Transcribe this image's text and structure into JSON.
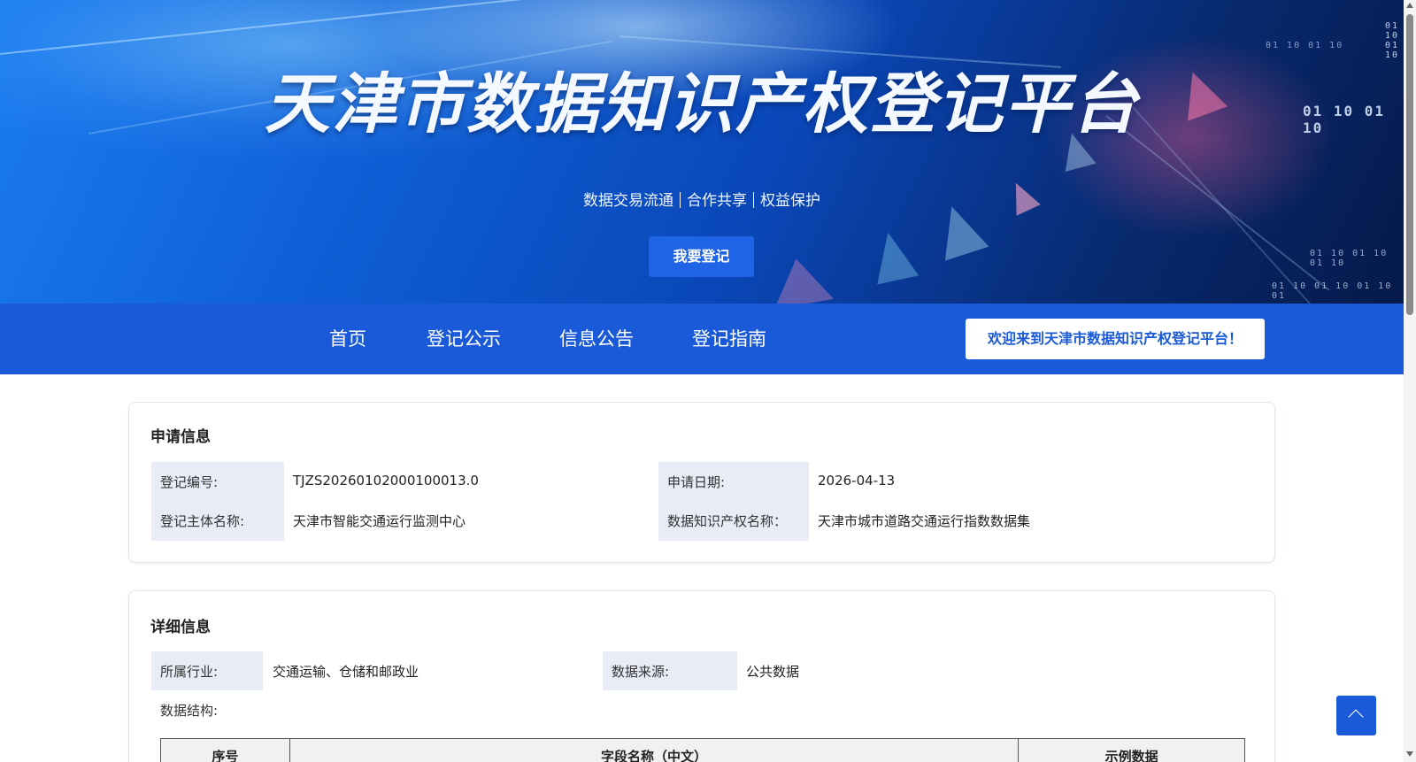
{
  "hero": {
    "title": "天津市数据知识产权登记平台",
    "subtitle_parts": [
      "数据交易流通",
      "合作共享",
      "权益保护"
    ],
    "register_button": "我要登记",
    "binary_top": "01 10 01 10",
    "binary_mid": "01 10 01 10",
    "binary_low": "01 10 01 10 01 10",
    "binary_bottom": "01 10 01 10 01 10 01"
  },
  "nav": {
    "items": [
      "首页",
      "登记公示",
      "信息公告",
      "登记指南"
    ],
    "welcome": "欢迎来到天津市数据知识产权登记平台！"
  },
  "application": {
    "title": "申请信息",
    "registration_no_label": "登记编号:",
    "registration_no": "TJZS20260102000100013.0",
    "apply_date_label": "申请日期:",
    "apply_date": "2026-04-13",
    "subject_label": "登记主体名称:",
    "subject": "天津市智能交通运行监测中心",
    "ip_name_label": "数据知识产权名称：",
    "ip_name": "天津市城市道路交通运行指数数据集"
  },
  "details": {
    "title": "详细信息",
    "industry_label": "所属行业:",
    "industry": "交通运输、仓储和邮政业",
    "source_label": "数据来源:",
    "source": "公共数据",
    "structure_label": "数据结构:",
    "table_headers": [
      "序号",
      "字段名称（中文）",
      "示例数据"
    ]
  },
  "colors": {
    "nav_blue": "#1a5ad8",
    "button_blue": "#1f63e6",
    "label_bg": "#e7ecf6"
  },
  "icons": {
    "back_to_top": "chevron-up-icon"
  }
}
